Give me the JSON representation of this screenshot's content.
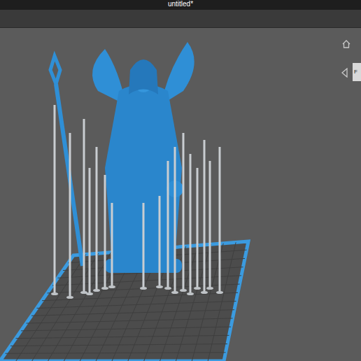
{
  "window": {
    "title": "untitled*"
  },
  "view_cube": {
    "label": "F"
  }
}
